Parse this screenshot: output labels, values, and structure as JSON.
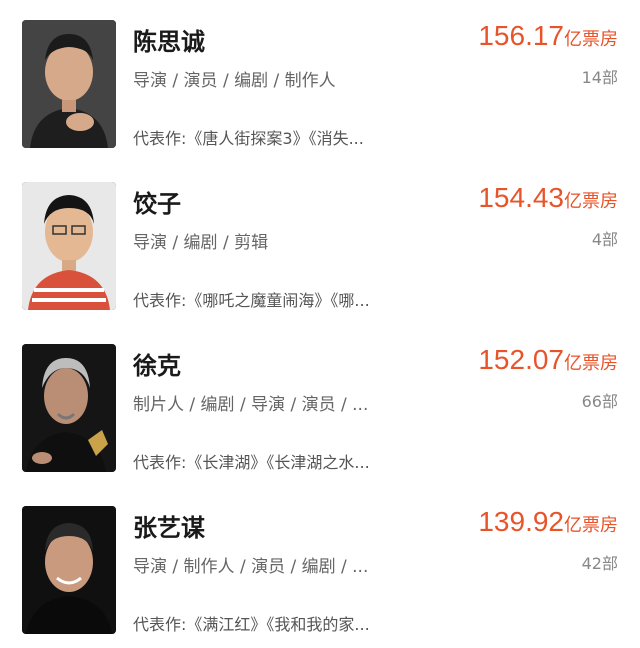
{
  "colors": {
    "accent": "#e8542a",
    "name": "#1a1a1a",
    "meta": "#666666"
  },
  "people": [
    {
      "name": "陈思诚",
      "roles": "导演 / 演员 / 编剧 / 制作人",
      "works": "代表作:《唐人街探案3》《消失...",
      "box_office": "156.17",
      "box_office_unit": "亿票房",
      "film_count": "14部",
      "avatar_icon": "portrait-photo"
    },
    {
      "name": "饺子",
      "roles": "导演 / 编剧 / 剪辑",
      "works": "代表作:《哪吒之魔童闹海》《哪...",
      "box_office": "154.43",
      "box_office_unit": "亿票房",
      "film_count": "4部",
      "avatar_icon": "portrait-photo"
    },
    {
      "name": "徐克",
      "roles": "制片人 / 编剧 / 导演 / 演员 / ...",
      "works": "代表作:《长津湖》《长津湖之水...",
      "box_office": "152.07",
      "box_office_unit": "亿票房",
      "film_count": "66部",
      "avatar_icon": "portrait-photo"
    },
    {
      "name": "张艺谋",
      "roles": "导演 / 制作人 / 演员 / 编剧 / ...",
      "works": "代表作:《满江红》《我和我的家...",
      "box_office": "139.92",
      "box_office_unit": "亿票房",
      "film_count": "42部",
      "avatar_icon": "portrait-photo"
    }
  ]
}
